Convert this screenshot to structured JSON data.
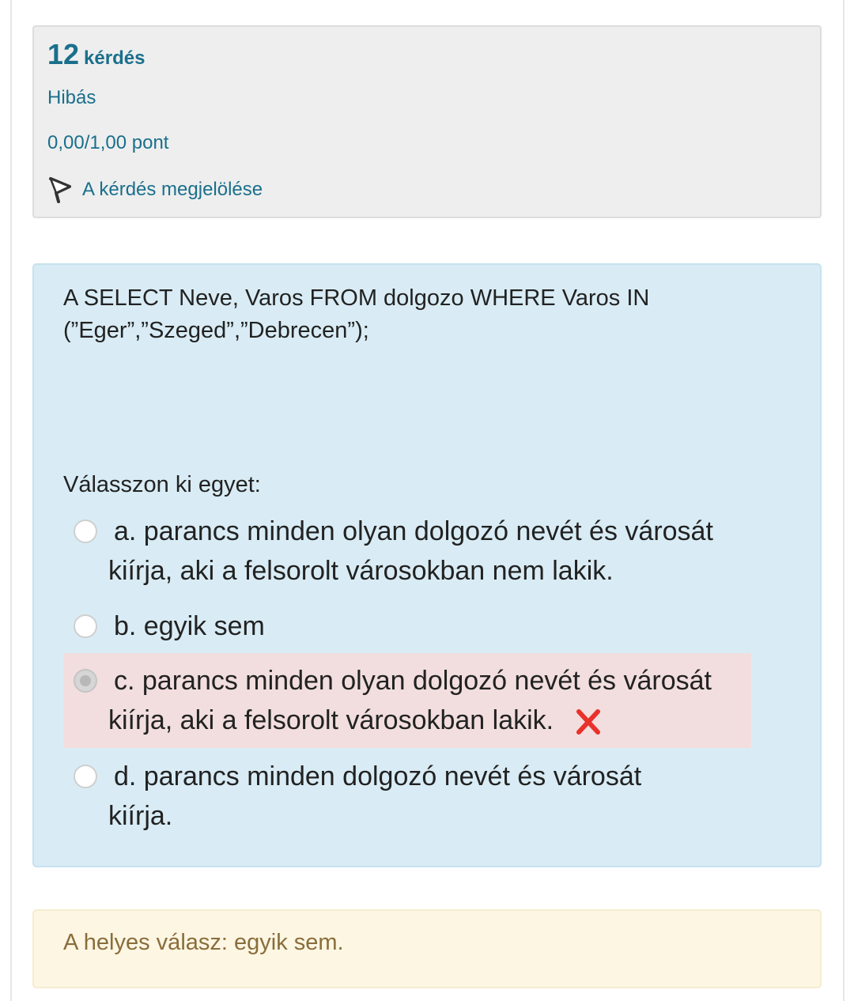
{
  "info": {
    "question_number": "12",
    "question_word": "kérdés",
    "state": "Hibás",
    "grade": "0,00/1,00 pont",
    "flag_label": "A kérdés megjelölése",
    "flag_icon": "flag-icon"
  },
  "question": {
    "text_line1": "A SELECT Neve, Varos FROM dolgozo WHERE Varos IN",
    "text_line2": "(”Eger”,”Szeged”,”Debrecen”);",
    "prompt": "Válasszon ki egyet:",
    "answers": [
      {
        "line1": "a. parancs minden olyan dolgozó nevét és városát",
        "line2": "kiírja, aki a felsorolt városokban nem lakik.",
        "selected": false,
        "incorrect": false
      },
      {
        "line1": "b. egyik sem",
        "selected": false,
        "incorrect": false
      },
      {
        "line1": "c. parancs minden olyan dolgozó nevét és városát",
        "line2": "kiírja, aki a felsorolt városokban lakik.",
        "selected": true,
        "incorrect": true,
        "mark_icon": "cross-icon"
      },
      {
        "line1": "d. parancs minden dolgozó nevét és városát",
        "line2": "kiírja.",
        "selected": false,
        "incorrect": false
      }
    ]
  },
  "feedback": {
    "right_answer": "A helyes válasz: egyik sem."
  },
  "colors": {
    "info_text": "#1a6f8c",
    "question_bg": "#d9ecf5",
    "incorrect_bg": "#f2dede",
    "feedback_bg": "#fcf6e3",
    "feedback_text": "#8a6d3b",
    "cross": "#e8322b"
  }
}
